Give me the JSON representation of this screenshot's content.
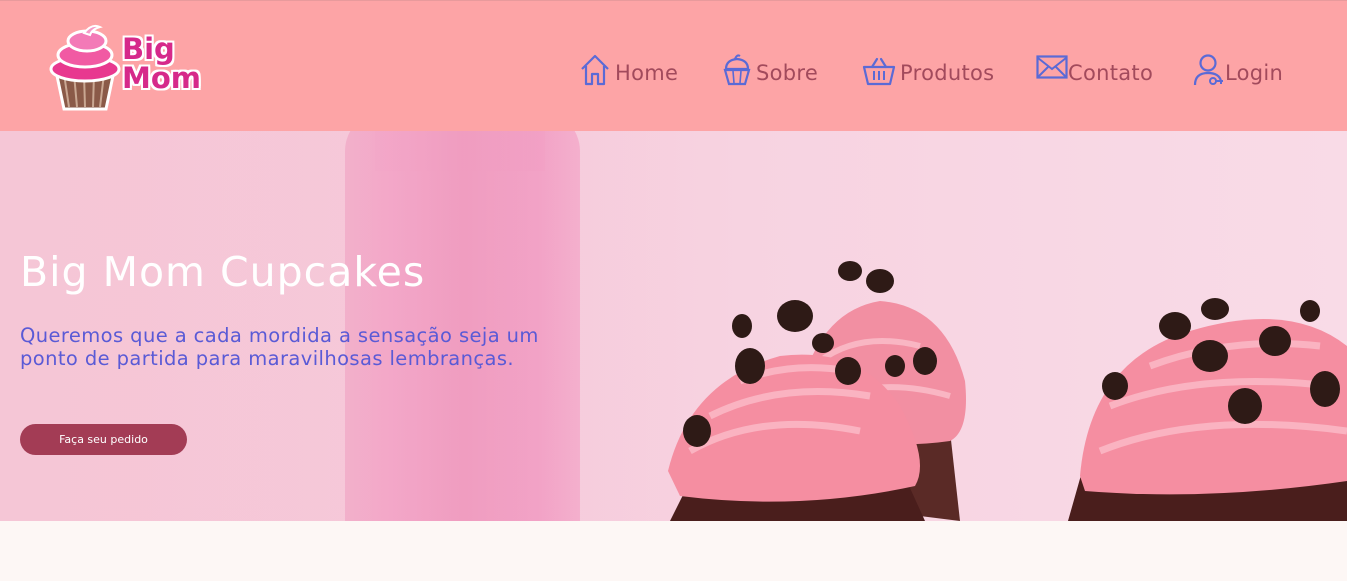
{
  "brand": {
    "logo_line1": "Big",
    "logo_line2": "Mom"
  },
  "nav": [
    {
      "icon": "home-icon",
      "label": "Home"
    },
    {
      "icon": "cupcake-icon",
      "label": "Sobre"
    },
    {
      "icon": "basket-icon",
      "label": "Produtos"
    },
    {
      "icon": "envelope-icon",
      "label": "Contato"
    },
    {
      "icon": "user-icon",
      "label": "Login"
    }
  ],
  "hero": {
    "title": "Big Mom Cupcakes",
    "subtitle": "Queremos que a cada mordida a sensação seja um ponto de partida para maravilhosas lembranças.",
    "cta_label": "Faça seu pedido"
  },
  "colors": {
    "header_bg": "#fda4a6",
    "nav_text": "#a24a5c",
    "nav_icon": "#5a6ad6",
    "hero_subtitle": "#5a5ad6",
    "cta_bg": "#a33c55",
    "page_bg": "#fdf7f5"
  }
}
